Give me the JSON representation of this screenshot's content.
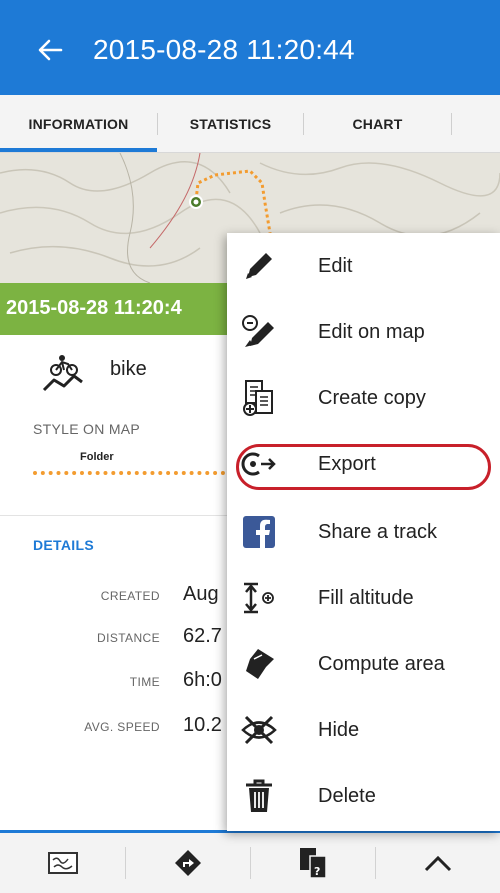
{
  "appbar": {
    "title": "2015-08-28 11:20:44"
  },
  "tabs": [
    {
      "label": "INFORMATION",
      "active": true
    },
    {
      "label": "STATISTICS",
      "active": false
    },
    {
      "label": "CHART",
      "active": false
    }
  ],
  "map": {
    "track_name": "2015-08-28 11:20:4",
    "track_color": "#f39c30",
    "banner_color": "#7cb342"
  },
  "activity": {
    "icon": "bike-icon",
    "label": "bike"
  },
  "style_on_map": {
    "label": "STYLE ON MAP",
    "folder_label": "Folder"
  },
  "details": {
    "label": "DETAILS",
    "rows": [
      {
        "key": "CREATED",
        "value": "Aug"
      },
      {
        "key": "DISTANCE",
        "value": "62.7"
      },
      {
        "key": "TIME",
        "value": "6h:0"
      },
      {
        "key": "AVG. SPEED",
        "value": "10.2"
      }
    ]
  },
  "menu": {
    "highlight_color": "#c8202a",
    "items": [
      {
        "label": "Edit",
        "icon": "pencil-icon"
      },
      {
        "label": "Edit on map",
        "icon": "edit-on-map-icon"
      },
      {
        "label": "Create copy",
        "icon": "copy-icon"
      },
      {
        "label": "Export",
        "icon": "export-icon",
        "highlighted": true
      },
      {
        "label": "Share a track",
        "icon": "facebook-icon"
      },
      {
        "label": "Fill altitude",
        "icon": "altitude-icon"
      },
      {
        "label": "Compute area",
        "icon": "area-icon"
      },
      {
        "label": "Hide",
        "icon": "hide-icon"
      },
      {
        "label": "Delete",
        "icon": "trash-icon"
      }
    ]
  },
  "bottombar": {
    "items": [
      {
        "icon": "map-icon"
      },
      {
        "icon": "navigate-icon"
      },
      {
        "icon": "tools-icon"
      },
      {
        "icon": "chevron-up-icon"
      }
    ]
  },
  "colors": {
    "primary": "#1e7ad6",
    "accent": "#f39c30"
  }
}
